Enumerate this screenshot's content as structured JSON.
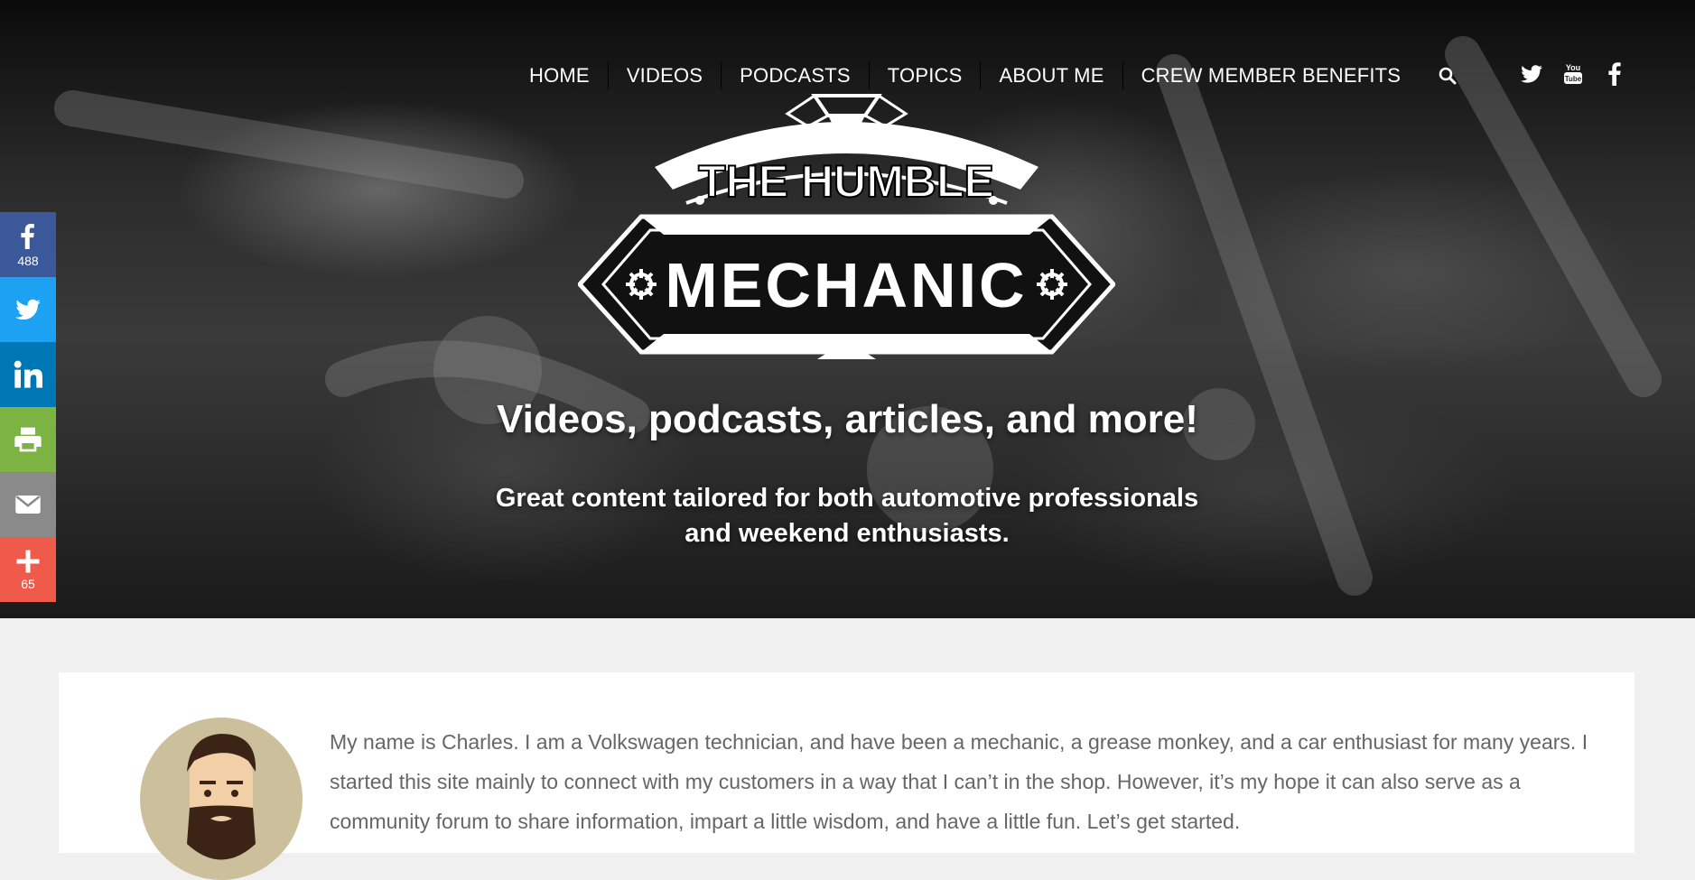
{
  "nav": {
    "items": [
      "HOME",
      "VIDEOS",
      "PODCASTS",
      "TOPICS",
      "ABOUT ME",
      "CREW MEMBER BENEFITS"
    ]
  },
  "icons": {
    "search": "search-icon",
    "social": [
      "twitter-icon",
      "youtube-icon",
      "facebook-icon"
    ]
  },
  "logo": {
    "line1": "THE HUMBLE",
    "line2": "MECHANIC"
  },
  "hero": {
    "headline": "Videos, podcasts, articles, and more!",
    "subline_1": "Great content tailored for both automotive professionals",
    "subline_2": "and weekend enthusiasts."
  },
  "share": {
    "facebook_count": "488",
    "more_count": "65",
    "colors": {
      "facebook": "#3b5998",
      "twitter": "#1da1f2",
      "linkedin": "#0077b5",
      "print": "#7cb342",
      "email": "#8a8a8a",
      "more": "#f05a4a"
    }
  },
  "content": {
    "intro": "My name is Charles. I am a Volkswagen technician, and have been a mechanic, a grease monkey, and a car enthusiast for many years. I started this site mainly to connect with my customers in a way that I can’t in the shop. However, it’s my hope it can also serve as a community forum to share information, impart a little wisdom, and have a little fun. Let’s get started."
  }
}
